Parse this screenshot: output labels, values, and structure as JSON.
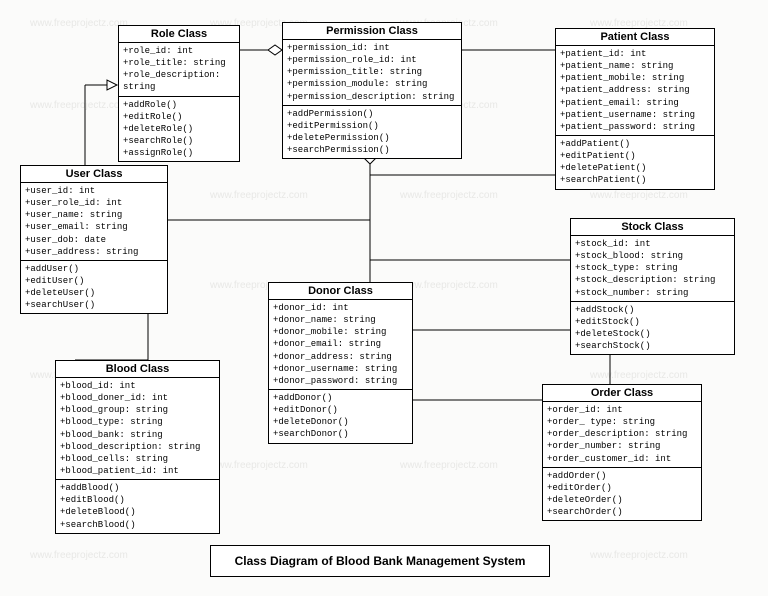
{
  "diagram_title": "Class Diagram of Blood Bank Management System",
  "watermark": "www.freeprojectz.com",
  "classes": {
    "role": {
      "title": "Role Class",
      "attrs": [
        "+role_id: int",
        "+role_title: string",
        "+role_description: string"
      ],
      "ops": [
        "+addRole()",
        "+editRole()",
        "+deleteRole()",
        "+searchRole()",
        "+assignRole()"
      ]
    },
    "permission": {
      "title": "Permission Class",
      "attrs": [
        "+permission_id: int",
        "+permission_role_id: int",
        "+permission_title: string",
        "+permission_module: string",
        "+permission_description: string"
      ],
      "ops": [
        "+addPermission()",
        "+editPermission()",
        "+deletePermission()",
        "+searchPermission()"
      ]
    },
    "patient": {
      "title": "Patient Class",
      "attrs": [
        "+patient_id: int",
        "+patient_name: string",
        "+patient_mobile: string",
        "+patient_address: string",
        "+patient_email: string",
        "+patient_username: string",
        "+patient_password: string"
      ],
      "ops": [
        "+addPatient()",
        "+editPatient()",
        "+deletePatient()",
        "+searchPatient()"
      ]
    },
    "user": {
      "title": "User Class",
      "attrs": [
        "+user_id: int",
        "+user_role_id: int",
        "+user_name: string",
        "+user_email: string",
        "+user_dob: date",
        "+user_address: string"
      ],
      "ops": [
        "+addUser()",
        "+editUser()",
        "+deleteUser()",
        "+searchUser()"
      ]
    },
    "stock": {
      "title": "Stock Class",
      "attrs": [
        "+stock_id: int",
        "+stock_blood: string",
        "+stock_type: string",
        "+stock_description: string",
        "+stock_number: string"
      ],
      "ops": [
        "+addStock()",
        "+editStock()",
        "+deleteStock()",
        "+searchStock()"
      ]
    },
    "donor": {
      "title": "Donor Class",
      "attrs": [
        "+donor_id: int",
        "+donor_name: string",
        "+donor_mobile: string",
        "+donor_email: string",
        "+donor_address: string",
        "+donor_username: string",
        "+donor_password: string"
      ],
      "ops": [
        "+addDonor()",
        "+editDonor()",
        "+deleteDonor()",
        "+searchDonor()"
      ]
    },
    "blood": {
      "title": "Blood Class",
      "attrs": [
        "+blood_id: int",
        "+blood_doner_id: int",
        "+blood_group: string",
        "+blood_type: string",
        "+blood_bank: string",
        "+blood_description: string",
        "+blood_cells: string",
        "+blood_patient_id: int"
      ],
      "ops": [
        "+addBlood()",
        "+editBlood()",
        "+deleteBlood()",
        "+searchBlood()"
      ]
    },
    "order": {
      "title": "Order Class",
      "attrs": [
        "+order_id: int",
        "+order_ type: string",
        "+order_description: string",
        "+order_number: string",
        "+order_customer_id: int"
      ],
      "ops": [
        "+addOrder()",
        "+editOrder()",
        "+deleteOrder()",
        "+searchOrder()"
      ]
    }
  }
}
